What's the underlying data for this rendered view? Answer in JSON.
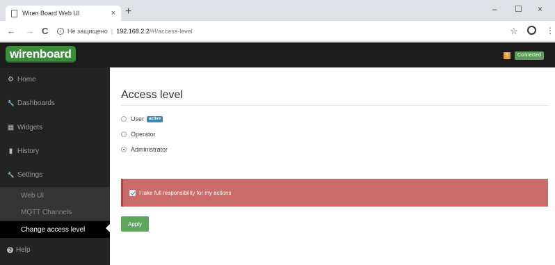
{
  "browser": {
    "tab_title": "Wiren Board Web UI",
    "tab_close": "×",
    "new_tab": "+",
    "window_controls": {
      "minimize": "–",
      "maximize": "☐",
      "close": "×"
    },
    "nav": {
      "back": "←",
      "forward": "→",
      "reload": "C"
    },
    "info_glyph": "i",
    "security_label": "Не защищено",
    "address_separator": "|",
    "url_host": "192.168.2.2",
    "url_path": "/#!/access-level",
    "star": "☆",
    "kebab": "⋮"
  },
  "header": {
    "logo": "wirenboard",
    "warning_glyph": "!",
    "status_label": "Connected",
    "colors": {
      "bg": "#1c1c1c",
      "logo_green": "#3b8c3b",
      "status_green": "#5c9e5c",
      "warning": "#e6a23c"
    }
  },
  "sidebar": {
    "items": [
      {
        "label": "Home",
        "icon": "gear-icon",
        "glyph": "⚙"
      },
      {
        "label": "Dashboards",
        "icon": "wrench-icon",
        "glyph": "🔧"
      },
      {
        "label": "Widgets",
        "icon": "widgets-icon",
        "glyph": "▦"
      },
      {
        "label": "History",
        "icon": "bar-chart-icon",
        "glyph": "▮"
      },
      {
        "label": "Settings",
        "icon": "wrench-icon",
        "glyph": "🔧"
      }
    ],
    "subitems": [
      {
        "label": "Web UI"
      },
      {
        "label": "MQTT Channels"
      },
      {
        "label": "Change access level"
      }
    ],
    "help": {
      "label": "Help",
      "icon": "question-circle-icon",
      "glyph": "?"
    }
  },
  "main": {
    "title": "Access level",
    "roles": [
      {
        "label": "User",
        "badge": "active",
        "checked": false
      },
      {
        "label": "Operator",
        "checked": false
      },
      {
        "label": "Administrator",
        "checked": true
      }
    ],
    "alert_text": "I take full responsibility for my actions",
    "alert_checked": true,
    "apply_label": "Apply",
    "colors": {
      "alert_bg": "#c96b6b",
      "apply_bg": "#5ea55e",
      "badge_bg": "#3d86b8"
    }
  }
}
